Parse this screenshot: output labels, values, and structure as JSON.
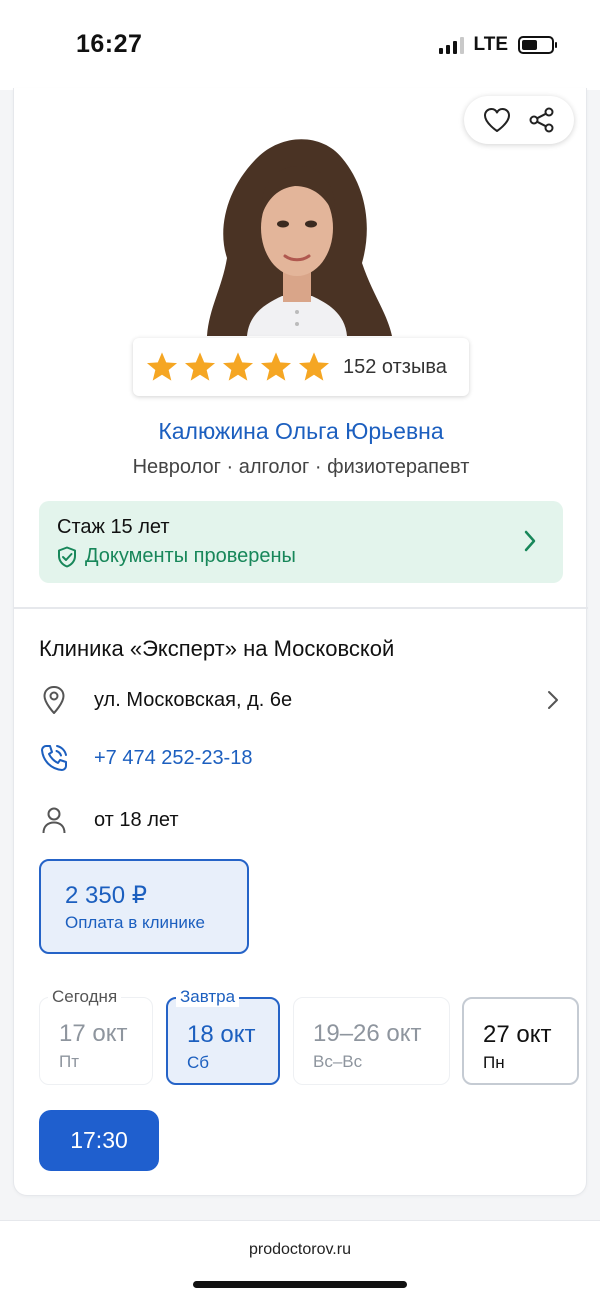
{
  "status_bar": {
    "time": "16:27",
    "network": "LTE"
  },
  "doctor": {
    "name": "Калюжина Ольга Юрьевна",
    "specialties": "Невролог · алголог · физиотерапевт",
    "rating_stars": 5,
    "reviews": "152 отзыва"
  },
  "experience": {
    "title": "Стаж 15 лет",
    "verified": "Документы проверены"
  },
  "clinic": {
    "name": "Клиника «Эксперт» на Московской",
    "address": "ул. Московская, д. 6е",
    "phone": "+7 474 252-23-18",
    "age": "от 18 лет"
  },
  "price": {
    "value": "2 350 ₽",
    "note": "Оплата в клинике"
  },
  "dates": [
    {
      "label": "Сегодня",
      "date": "17 окт",
      "day": "Пт"
    },
    {
      "label": "Завтра",
      "date": "18 окт",
      "day": "Сб"
    },
    {
      "label": "",
      "date": "19–26 окт",
      "day": "Вс–Вс"
    },
    {
      "label": "",
      "date": "27 окт",
      "day": "Пн"
    }
  ],
  "time_slots": [
    "17:30"
  ],
  "browser": {
    "url": "prodoctorov.ru"
  },
  "colors": {
    "accent": "#1c5fbf",
    "star": "#f5a623",
    "verified": "#18875a",
    "verified_bg": "#e3f4ec"
  }
}
